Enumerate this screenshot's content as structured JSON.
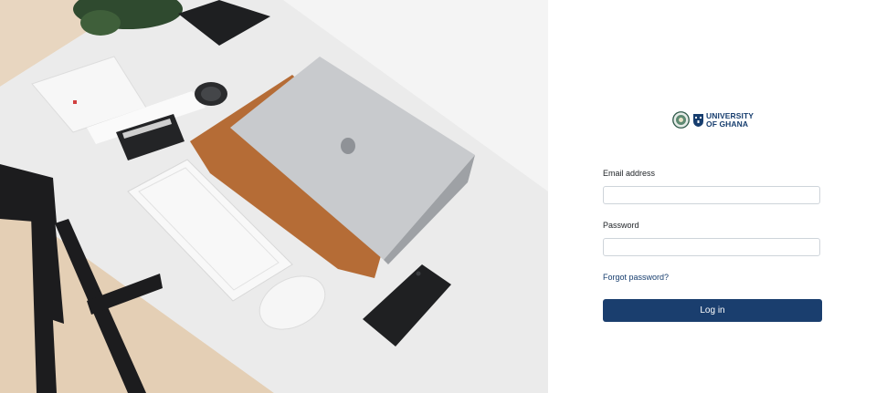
{
  "hero": {
    "image": "desk-workspace-photo",
    "colors": {
      "desk": "#ececec",
      "floor": "#e7d5bf",
      "sleeve": "#b8703c",
      "laptop": "#c6c8cb",
      "phone": "#202225"
    }
  },
  "logo": {
    "line1": "UNIVERSITY",
    "line2": "OF GHANA",
    "seal_icon": "university-seal-icon",
    "crest_icon": "university-crest-icon"
  },
  "form": {
    "email_label": "Email address",
    "email_value": "",
    "password_label": "Password",
    "password_value": "",
    "forgot_link": "Forgot password?",
    "login_button": "Log in"
  },
  "colors": {
    "brand": "#1a3e6e",
    "link": "#163d6e",
    "input_border": "#ced4da"
  }
}
